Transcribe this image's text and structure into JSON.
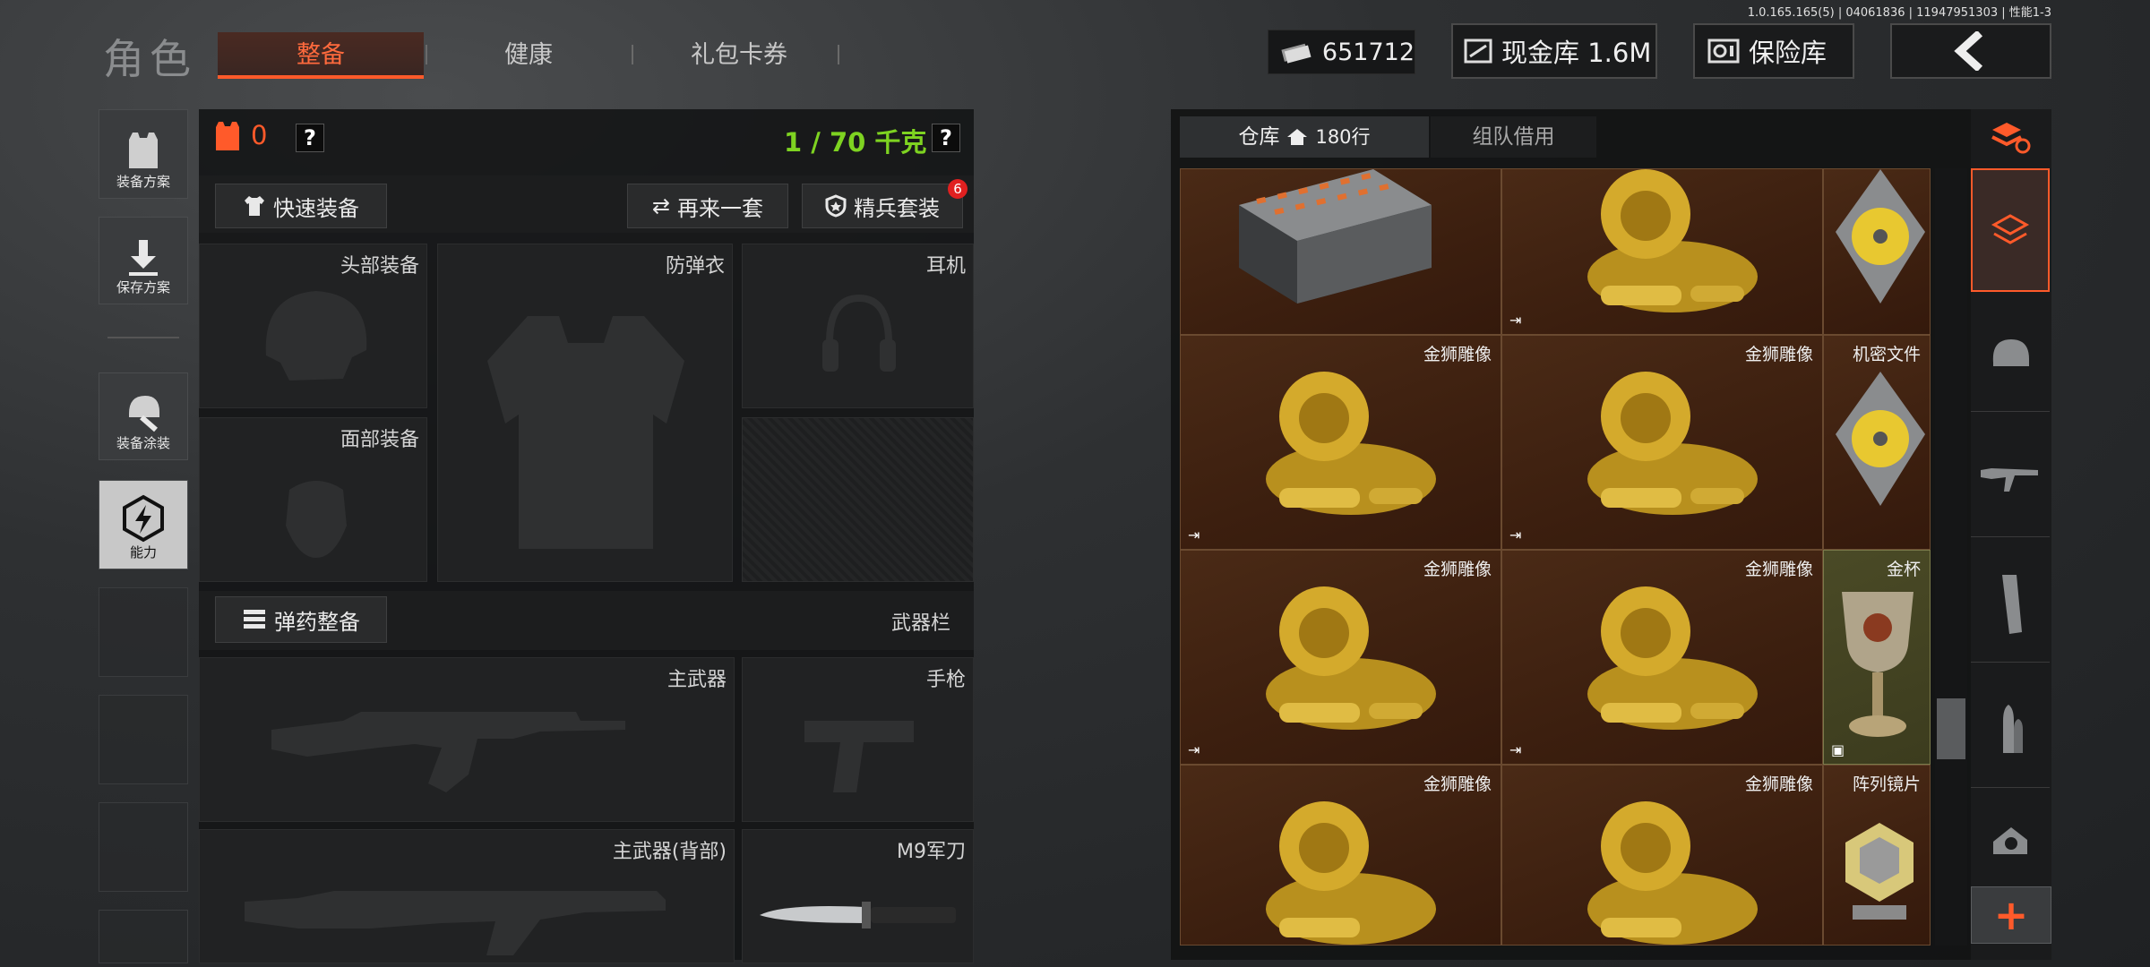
{
  "version": "1.0.165.165(5) | 04061836 | 11947951303 | 性能1-3",
  "page_title": "角色",
  "tabs": [
    {
      "label": "整备",
      "active": true
    },
    {
      "label": "健康",
      "active": false
    },
    {
      "label": "礼包卡券",
      "active": false
    }
  ],
  "header": {
    "currency_value": "651712",
    "cash_label": "现金库 1.6M",
    "safe_label": "保险库",
    "back_icon": "chevron-left-icon"
  },
  "sidebar": {
    "items": [
      {
        "label": "装备方案",
        "icon": "vest-icon"
      },
      {
        "label": "保存方案",
        "icon": "download-icon"
      },
      {
        "label": "装备涂装",
        "icon": "helmet-paint-icon"
      },
      {
        "label": "能力",
        "icon": "lightning-icon"
      }
    ]
  },
  "loadout": {
    "armor_count": "0",
    "help": "?",
    "weight": "1 / 70 千克",
    "quick_equip": "快速装备",
    "again_set": "再来一套",
    "elite_set": "精兵套装",
    "elite_badge": "6",
    "slots": {
      "head": "头部装备",
      "vest": "防弹衣",
      "headset": "耳机",
      "face": "面部装备",
      "ammo": "弹药整备",
      "weapon_bar": "武器栏",
      "primary": "主武器",
      "pistol": "手枪",
      "primary_back": "主武器(背部)",
      "knife": "M9军刀"
    }
  },
  "warehouse": {
    "tab_storage": "仓库",
    "rows": "180行",
    "tab_team": "组队借用",
    "cells": [
      {
        "name": "",
        "type": "crate"
      },
      {
        "name": "",
        "type": "lion"
      },
      {
        "name": "",
        "type": "disc"
      },
      {
        "name": "金狮雕像",
        "type": "lion"
      },
      {
        "name": "金狮雕像",
        "type": "lion"
      },
      {
        "name": "机密文件",
        "type": "disc"
      },
      {
        "name": "金狮雕像",
        "type": "lion"
      },
      {
        "name": "金狮雕像",
        "type": "lion"
      },
      {
        "name": "金杯",
        "type": "cup"
      },
      {
        "name": "金狮雕像",
        "type": "lion"
      },
      {
        "name": "金狮雕像",
        "type": "lion"
      },
      {
        "name": "阵列镜片",
        "type": "lens"
      }
    ]
  },
  "categories": [
    "refresh-stack-icon",
    "stack-icon",
    "helmet-icon",
    "rifle-icon",
    "magazine-icon",
    "bullet-icon",
    "scope-icon",
    "plus-icon"
  ],
  "colors": {
    "accent": "#ff5a2a",
    "weight_green": "#7ed321",
    "cell_brown": "#3c1f0f"
  }
}
